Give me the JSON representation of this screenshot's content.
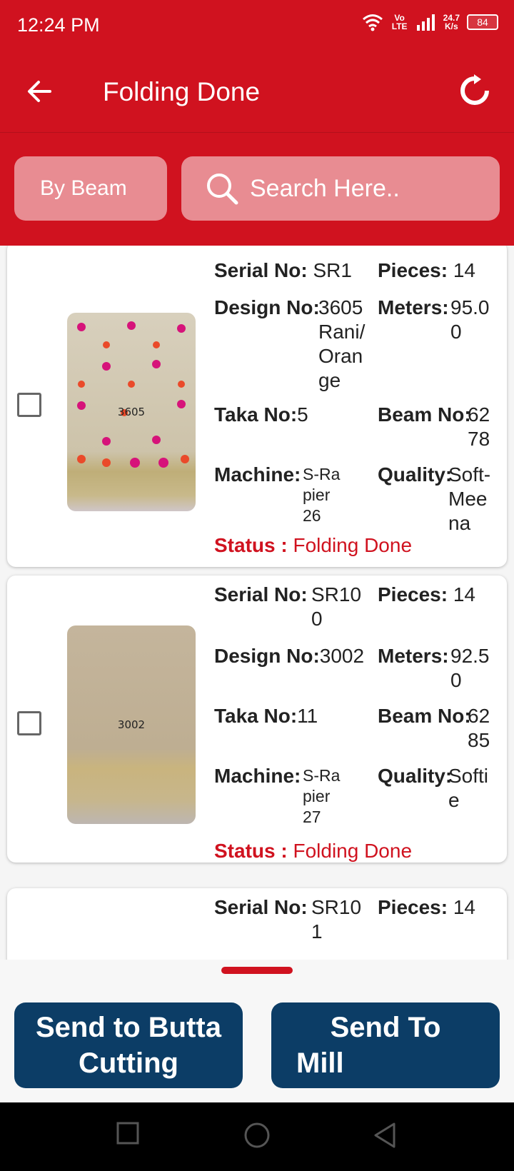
{
  "status_bar": {
    "time": "12:24 PM",
    "network_type": "Vo LTE",
    "speed": "24.7",
    "speed_unit": "K/s",
    "battery": "84"
  },
  "app_bar": {
    "title": "Folding Done",
    "back_icon": "arrow-left-icon",
    "refresh_icon": "refresh-icon"
  },
  "filter": {
    "by_beam_label": "By Beam",
    "search_placeholder": "Search Here.."
  },
  "items": [
    {
      "serial_label": "Serial No:",
      "serial": "SR1",
      "pieces_label": "Pieces:",
      "pieces": "14",
      "design_label": "Design No:",
      "design": "3605 Rani/ Orange",
      "meters_label": "Meters:",
      "meters": "95.00",
      "taka_label": "Taka No:",
      "taka": "5",
      "beam_label": "Beam No:",
      "beam": "6278",
      "machine_label": "Machine:",
      "machine": "S-Rapier 26",
      "quality_label": "Quality:",
      "quality": "Soft-Meena",
      "status_label": "Status :",
      "status": "Folding Done",
      "image_label": "3605"
    },
    {
      "serial_label": "Serial No:",
      "serial": "SR100",
      "pieces_label": "Pieces:",
      "pieces": "14",
      "design_label": "Design No:",
      "design": "3002",
      "meters_label": "Meters:",
      "meters": "92.50",
      "taka_label": "Taka No:",
      "taka": "11",
      "beam_label": "Beam No:",
      "beam": "6285",
      "machine_label": "Machine:",
      "machine": "S-Rapier 27",
      "quality_label": "Quality:",
      "quality": "Softie",
      "status_label": "Status :",
      "status": "Folding Done",
      "image_label": "3002"
    },
    {
      "serial_label": "Serial No:",
      "serial": "SR101",
      "pieces_label": "Pieces:",
      "pieces": "14"
    }
  ],
  "actions": {
    "butta_line1": "Send to Butta",
    "butta_line2": "Cutting",
    "mill_line1": "Send To",
    "mill_line2": "Mill"
  },
  "colors": {
    "primary": "#d0121f",
    "button": "#0c3d66",
    "status_text": "#d0121f"
  }
}
